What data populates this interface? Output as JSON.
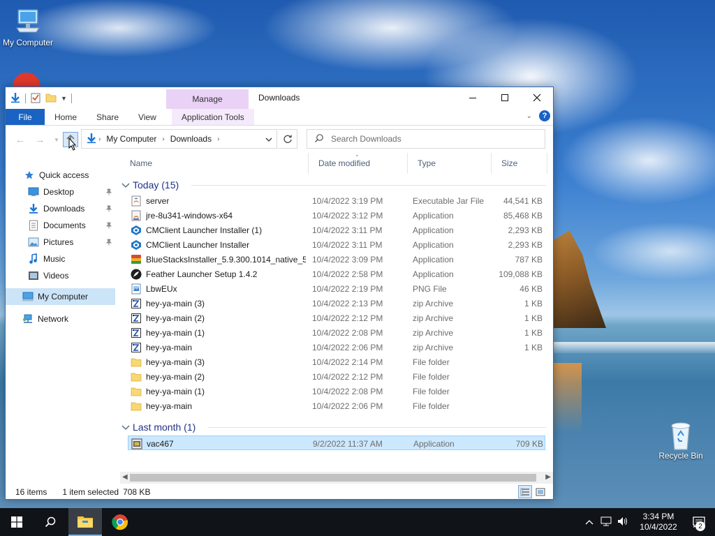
{
  "desktop": {
    "icons": [
      {
        "label": "My Computer",
        "icon": "computer-icon"
      },
      {
        "label": "Recycle Bin",
        "icon": "recycle-bin-icon"
      }
    ]
  },
  "window": {
    "title": "Downloads",
    "contextual_tab_group": "Manage",
    "ribbon_tabs": [
      "File",
      "Home",
      "Share",
      "View",
      "Application Tools"
    ],
    "colors": {
      "accent": "#1a63c2",
      "manage_tab": "#ead2f6",
      "selection": "#cce8ff",
      "group_header": "#1e3287"
    }
  },
  "address_bar": {
    "breadcrumb": [
      "My Computer",
      "Downloads"
    ]
  },
  "search": {
    "placeholder": "Search Downloads"
  },
  "nav_pane": {
    "quick_access": {
      "label": "Quick access",
      "items": [
        {
          "label": "Desktop",
          "icon": "desktop-icon",
          "pinned": true
        },
        {
          "label": "Downloads",
          "icon": "downloads-icon",
          "pinned": true
        },
        {
          "label": "Documents",
          "icon": "documents-icon",
          "pinned": true
        },
        {
          "label": "Pictures",
          "icon": "pictures-icon",
          "pinned": true
        },
        {
          "label": "Music",
          "icon": "music-icon",
          "pinned": false
        },
        {
          "label": "Videos",
          "icon": "videos-icon",
          "pinned": false
        }
      ]
    },
    "my_computer": {
      "label": "My Computer",
      "selected": true
    },
    "network": {
      "label": "Network"
    }
  },
  "columns": {
    "name": "Name",
    "date": "Date modified",
    "type": "Type",
    "size": "Size"
  },
  "groups": [
    {
      "label": "Today (15)",
      "files": [
        {
          "name": "server",
          "date": "10/4/2022 3:19 PM",
          "type": "Executable Jar File",
          "size": "44,541 KB",
          "icon": "jar-file-icon"
        },
        {
          "name": "jre-8u341-windows-x64",
          "date": "10/4/2022 3:12 PM",
          "type": "Application",
          "size": "85,468 KB",
          "icon": "java-installer-icon"
        },
        {
          "name": "CMClient Launcher Installer (1)",
          "date": "10/4/2022 3:11 PM",
          "type": "Application",
          "size": "2,293 KB",
          "icon": "cmclient-icon"
        },
        {
          "name": "CMClient Launcher Installer",
          "date": "10/4/2022 3:11 PM",
          "type": "Application",
          "size": "2,293 KB",
          "icon": "cmclient-icon"
        },
        {
          "name": "BlueStacksInstaller_5.9.300.1014_native_5...",
          "date": "10/4/2022 3:09 PM",
          "type": "Application",
          "size": "787 KB",
          "icon": "bluestacks-icon"
        },
        {
          "name": "Feather Launcher Setup 1.4.2",
          "date": "10/4/2022 2:58 PM",
          "type": "Application",
          "size": "109,088 KB",
          "icon": "feather-launcher-icon"
        },
        {
          "name": "LbwEUx",
          "date": "10/4/2022 2:19 PM",
          "type": "PNG File",
          "size": "46 KB",
          "icon": "png-file-icon"
        },
        {
          "name": "hey-ya-main (3)",
          "date": "10/4/2022 2:13 PM",
          "type": "zip Archive",
          "size": "1 KB",
          "icon": "zip-archive-icon"
        },
        {
          "name": "hey-ya-main (2)",
          "date": "10/4/2022 2:12 PM",
          "type": "zip Archive",
          "size": "1 KB",
          "icon": "zip-archive-icon"
        },
        {
          "name": "hey-ya-main (1)",
          "date": "10/4/2022 2:08 PM",
          "type": "zip Archive",
          "size": "1 KB",
          "icon": "zip-archive-icon"
        },
        {
          "name": "hey-ya-main",
          "date": "10/4/2022 2:06 PM",
          "type": "zip Archive",
          "size": "1 KB",
          "icon": "zip-archive-icon"
        },
        {
          "name": "hey-ya-main (3)",
          "date": "10/4/2022 2:14 PM",
          "type": "File folder",
          "size": "",
          "icon": "folder-icon"
        },
        {
          "name": "hey-ya-main (2)",
          "date": "10/4/2022 2:12 PM",
          "type": "File folder",
          "size": "",
          "icon": "folder-icon"
        },
        {
          "name": "hey-ya-main (1)",
          "date": "10/4/2022 2:08 PM",
          "type": "File folder",
          "size": "",
          "icon": "folder-icon"
        },
        {
          "name": "hey-ya-main",
          "date": "10/4/2022 2:06 PM",
          "type": "File folder",
          "size": "",
          "icon": "folder-icon"
        }
      ]
    },
    {
      "label": "Last month (1)",
      "files": [
        {
          "name": "vac467",
          "date": "9/2/2022 11:37 AM",
          "type": "Application",
          "size": "709 KB",
          "icon": "application-icon",
          "selected": true
        }
      ]
    }
  ],
  "status_bar": {
    "item_count": "16 items",
    "selection": "1 item selected",
    "selection_size": "708 KB"
  },
  "taskbar": {
    "time": "3:34 PM",
    "date": "10/4/2022",
    "notification_count": "2",
    "pinned": [
      "start-icon",
      "search-icon",
      "file-explorer-icon",
      "chrome-icon"
    ]
  }
}
